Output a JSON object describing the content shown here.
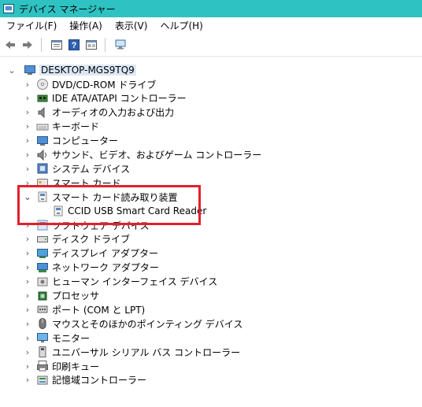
{
  "window": {
    "title": "デバイス マネージャー"
  },
  "menu": [
    "ファイル(F)",
    "操作(A)",
    "表示(V)",
    "ヘルプ(H)"
  ],
  "toolbar": {
    "buttons": [
      "back-icon",
      "forward-icon",
      "properties-icon",
      "help-icon",
      "view-icon",
      "scan-hardware-icon"
    ]
  },
  "tree": {
    "root": "DESKTOP-MGS9TQ9",
    "categories": [
      {
        "label": "DVD/CD-ROM ドライブ",
        "icon": "dvd-drive-icon",
        "expanded": false
      },
      {
        "label": "IDE ATA/ATAPI コントローラー",
        "icon": "ide-controller-icon",
        "expanded": false
      },
      {
        "label": "オーディオの入力および出力",
        "icon": "audio-icon",
        "expanded": false
      },
      {
        "label": "キーボード",
        "icon": "keyboard-icon",
        "expanded": false
      },
      {
        "label": "コンピューター",
        "icon": "computer-icon",
        "expanded": false
      },
      {
        "label": "サウンド、ビデオ、およびゲーム コントローラー",
        "icon": "sound-icon",
        "expanded": false
      },
      {
        "label": "システム デバイス",
        "icon": "system-device-icon",
        "expanded": false
      },
      {
        "label": "スマート カード",
        "icon": "smart-card-icon",
        "expanded": false
      },
      {
        "label": "スマート カード読み取り装置",
        "icon": "smart-card-reader-icon",
        "expanded": true,
        "children": [
          "CCID USB Smart Card Reader"
        ]
      },
      {
        "label": "ソフトウェア デバイス",
        "icon": "software-device-icon",
        "expanded": false
      },
      {
        "label": "ディスク ドライブ",
        "icon": "disk-drive-icon",
        "expanded": false
      },
      {
        "label": "ディスプレイ アダプター",
        "icon": "display-adapter-icon",
        "expanded": false
      },
      {
        "label": "ネットワーク アダプター",
        "icon": "network-adapter-icon",
        "expanded": false
      },
      {
        "label": "ヒューマン インターフェイス デバイス",
        "icon": "hid-icon",
        "expanded": false
      },
      {
        "label": "プロセッサ",
        "icon": "processor-icon",
        "expanded": false
      },
      {
        "label": "ポート (COM と LPT)",
        "icon": "port-icon",
        "expanded": false
      },
      {
        "label": "マウスとそのほかのポインティング デバイス",
        "icon": "mouse-icon",
        "expanded": false
      },
      {
        "label": "モニター",
        "icon": "monitor-icon",
        "expanded": false
      },
      {
        "label": "ユニバーサル シリアル バス コントローラー",
        "icon": "usb-icon",
        "expanded": false
      },
      {
        "label": "印刷キュー",
        "icon": "print-queue-icon",
        "expanded": false
      },
      {
        "label": "記憶域コントローラー",
        "icon": "storage-controller-icon",
        "expanded": false
      }
    ]
  },
  "colors": {
    "titlebar": "#2fc2c2",
    "highlight": "#e2202c",
    "selection": "#dde8f5"
  }
}
